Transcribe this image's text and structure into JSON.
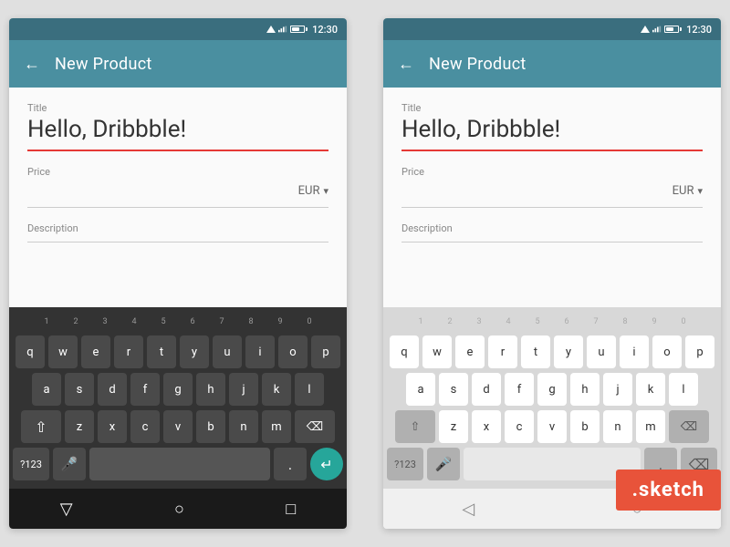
{
  "app": {
    "title": "New Product",
    "back_label": "←",
    "time": "12:30"
  },
  "form": {
    "title_label": "Title",
    "title_value": "Hello, Dribbble!",
    "price_label": "Price",
    "price_value": "",
    "currency": "EUR",
    "description_label": "Description",
    "description_value": ""
  },
  "keyboard": {
    "num_row": [
      "1",
      "2",
      "3",
      "4",
      "5",
      "6",
      "7",
      "8",
      "9",
      "0"
    ],
    "row1": [
      "q",
      "w",
      "e",
      "r",
      "t",
      "y",
      "u",
      "i",
      "o",
      "p"
    ],
    "row2": [
      "a",
      "s",
      "d",
      "f",
      "g",
      "h",
      "j",
      "k",
      "l"
    ],
    "row3": [
      "z",
      "x",
      "c",
      "v",
      "b",
      "n",
      "m"
    ],
    "special_left": "?123",
    "period": ".",
    "enter_icon": "↵"
  },
  "sketch_badge": ".sketch"
}
